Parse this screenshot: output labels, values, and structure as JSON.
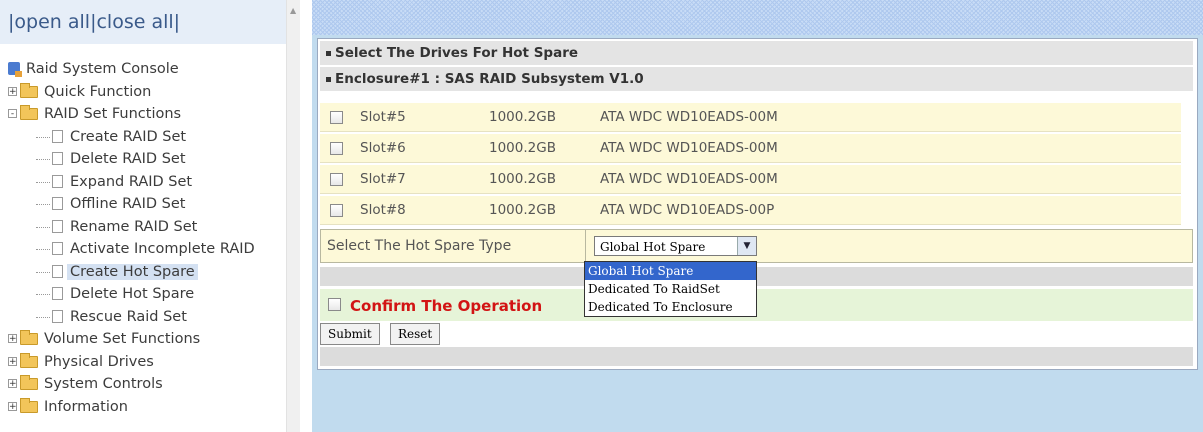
{
  "left_panel": {
    "open_all": "open all",
    "close_all": "close all",
    "root": "Raid System Console",
    "tree": [
      {
        "label": "Quick Function",
        "expand": "+"
      },
      {
        "label": "RAID Set Functions",
        "expand": "-"
      },
      {
        "label": "Create RAID Set"
      },
      {
        "label": "Delete RAID Set"
      },
      {
        "label": "Expand RAID Set"
      },
      {
        "label": "Offline RAID Set"
      },
      {
        "label": "Rename RAID Set"
      },
      {
        "label": "Activate Incomplete RAID"
      },
      {
        "label": "Create Hot Spare",
        "selected": true
      },
      {
        "label": "Delete Hot Spare"
      },
      {
        "label": "Rescue Raid Set"
      },
      {
        "label": "Volume Set Functions",
        "expand": "+"
      },
      {
        "label": "Physical Drives",
        "expand": "+"
      },
      {
        "label": "System Controls",
        "expand": "+"
      },
      {
        "label": "Information",
        "expand": "+"
      }
    ]
  },
  "main": {
    "section_title": "Select The Drives For Hot Spare",
    "enclosure_title": "Enclosure#1 : SAS RAID Subsystem V1.0",
    "drives": [
      {
        "slot": "Slot#5",
        "capacity": "1000.2GB",
        "model": "ATA WDC WD10EADS-00M"
      },
      {
        "slot": "Slot#6",
        "capacity": "1000.2GB",
        "model": "ATA WDC WD10EADS-00M"
      },
      {
        "slot": "Slot#7",
        "capacity": "1000.2GB",
        "model": "ATA WDC WD10EADS-00M"
      },
      {
        "slot": "Slot#8",
        "capacity": "1000.2GB",
        "model": "ATA WDC WD10EADS-00P"
      }
    ],
    "hot_spare_type_label": "Select The Hot Spare Type",
    "hot_spare_type_value": "Global Hot Spare",
    "dropdown_options": [
      "Global Hot Spare",
      "Dedicated To RaidSet",
      "Dedicated To Enclosure"
    ],
    "confirm_label": "Confirm The Operation",
    "submit_label": "Submit",
    "reset_label": "Reset"
  },
  "colors": {
    "row_bg": "#fdf9d8",
    "confirm_text": "#d21414",
    "panel_bg": "#c1dbee",
    "selected_option": "#3366cc"
  }
}
